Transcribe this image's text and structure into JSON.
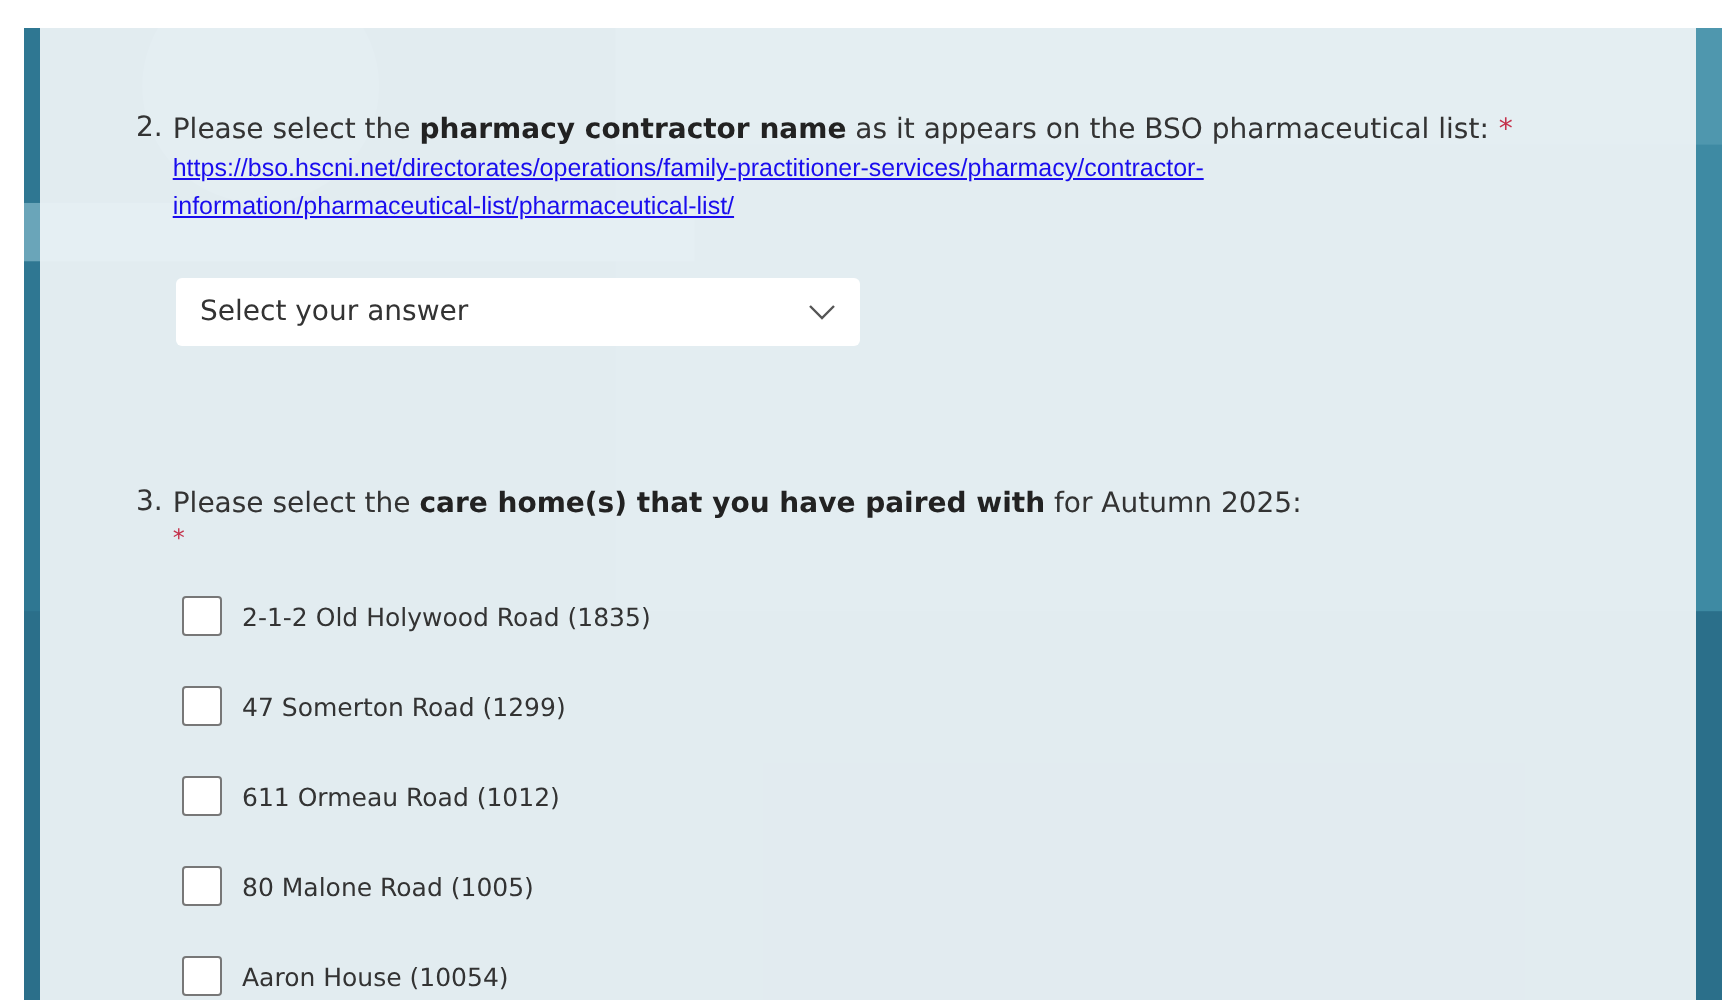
{
  "questions": [
    {
      "kind": "dropdown",
      "number": "2.",
      "prompt": "Please select the **pharmacy contractor name** as it appears on the BSO pharmaceutical list:",
      "required_mark": "*",
      "link_lines": [
        "https://bso.hscni.net/directorates/operations/family-practitioner-services/pharmacy/contractor-",
        "information/pharmaceutical-list/pharmaceutical-list/"
      ],
      "placeholder": "Select your answer"
    },
    {
      "kind": "checkboxes",
      "number": "3.",
      "prompt": "Please select the **care home(s) that you have paired with** for Autumn 2025:",
      "required_mark": "*",
      "required_on_new_line": true,
      "options": [
        {
          "label": "2-1-2 Old Holywood Road (1835)",
          "checked": false
        },
        {
          "label": "47 Somerton Road (1299)",
          "checked": false
        },
        {
          "label": "611 Ormeau Road (1012)",
          "checked": false
        },
        {
          "label": "80 Malone Road (1005)",
          "checked": false
        },
        {
          "label": "Aaron House (10054)",
          "checked": false
        }
      ]
    }
  ]
}
